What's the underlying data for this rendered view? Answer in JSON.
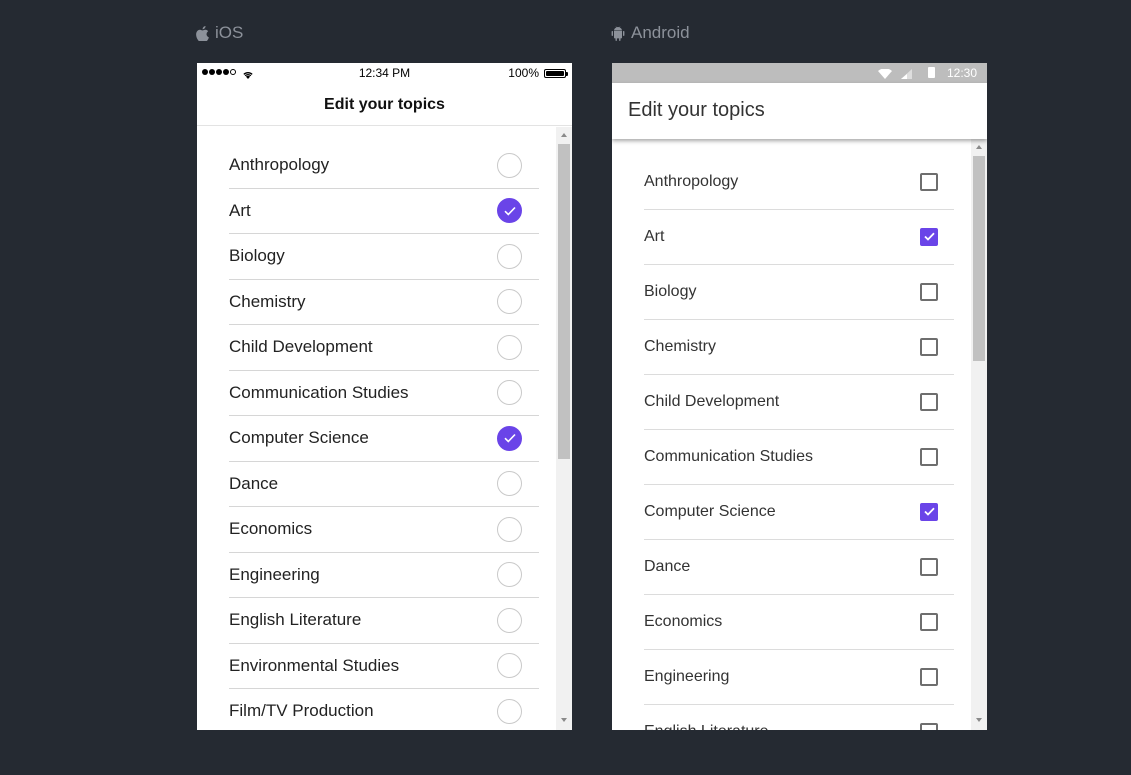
{
  "ios": {
    "label": "iOS",
    "status": {
      "time": "12:34 PM",
      "battery": "100%"
    },
    "title": "Edit your topics",
    "topics": [
      {
        "label": "Anthropology",
        "checked": false
      },
      {
        "label": "Art",
        "checked": true
      },
      {
        "label": "Biology",
        "checked": false
      },
      {
        "label": "Chemistry",
        "checked": false
      },
      {
        "label": "Child Development",
        "checked": false
      },
      {
        "label": "Communication Studies",
        "checked": false
      },
      {
        "label": "Computer Science",
        "checked": true
      },
      {
        "label": "Dance",
        "checked": false
      },
      {
        "label": "Economics",
        "checked": false
      },
      {
        "label": "Engineering",
        "checked": false
      },
      {
        "label": "English Literature",
        "checked": false
      },
      {
        "label": "Environmental Studies",
        "checked": false
      },
      {
        "label": "Film/TV Production",
        "checked": false
      }
    ]
  },
  "android": {
    "label": "Android",
    "status": {
      "time": "12:30"
    },
    "title": "Edit your topics",
    "topics": [
      {
        "label": "Anthropology",
        "checked": false
      },
      {
        "label": "Art",
        "checked": true
      },
      {
        "label": "Biology",
        "checked": false
      },
      {
        "label": "Chemistry",
        "checked": false
      },
      {
        "label": "Child Development",
        "checked": false
      },
      {
        "label": "Communication Studies",
        "checked": false
      },
      {
        "label": "Computer Science",
        "checked": true
      },
      {
        "label": "Dance",
        "checked": false
      },
      {
        "label": "Economics",
        "checked": false
      },
      {
        "label": "Engineering",
        "checked": false
      },
      {
        "label": "English Literature",
        "checked": false
      }
    ]
  },
  "colors": {
    "accent": "#6a44e8",
    "background": "#252a32",
    "label": "#8c919a"
  },
  "icons": {
    "ios_label": "apple-icon",
    "android_label": "android-icon"
  }
}
